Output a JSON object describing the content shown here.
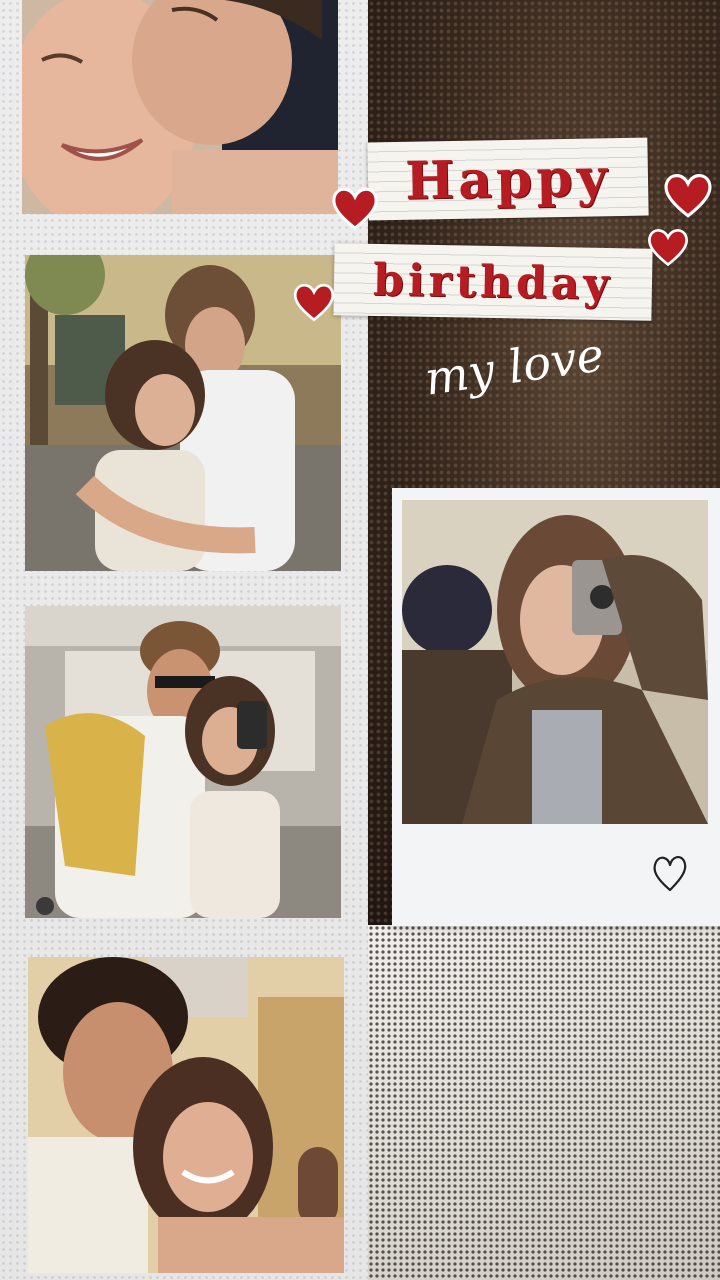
{
  "title": {
    "line1": "Happy",
    "line2": "birthday",
    "script": "my love"
  },
  "colors": {
    "heart": "#b51d23",
    "title_text": "#b51d23",
    "script_text": "#ffffff"
  },
  "photos": [
    {
      "name": "photo-kiss-closeup"
    },
    {
      "name": "photo-hug-street"
    },
    {
      "name": "photo-mirror-selfie-shop"
    },
    {
      "name": "photo-selfie-balcony"
    }
  ],
  "polaroid": {
    "doodle_icon": "heart-outline-icon"
  }
}
